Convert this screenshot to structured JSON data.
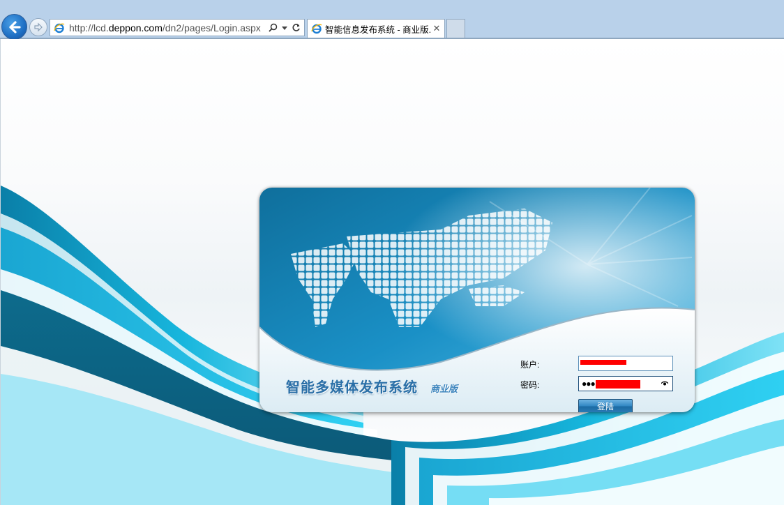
{
  "browser": {
    "url_prefix": "http://lcd.",
    "url_domain": "deppon.com",
    "url_path": "/dn2/pages/Login.aspx",
    "tab_title": "智能信息发布系统 - 商业版...",
    "tab_close": "✕"
  },
  "login": {
    "system_title": "智能多媒体发布系统",
    "edition": "商业版",
    "account_label": "账户:",
    "password_label": "密码:",
    "account_value": "",
    "password_mask": "●●●",
    "submit_label": "登陆"
  },
  "icons": {
    "back": "back-arrow-icon",
    "forward": "forward-arrow-icon",
    "ie": "internet-explorer-icon",
    "search": "search-icon",
    "dropdown": "dropdown-arrow-icon",
    "refresh": "refresh-icon",
    "reveal_password": "eye-icon"
  },
  "colors": {
    "chrome": "#b9d1ea",
    "accent": "#1e6fc4",
    "panel_blue": "#1a8cc4",
    "title_blue": "#2a6fa7",
    "redaction": "#ff0000"
  }
}
